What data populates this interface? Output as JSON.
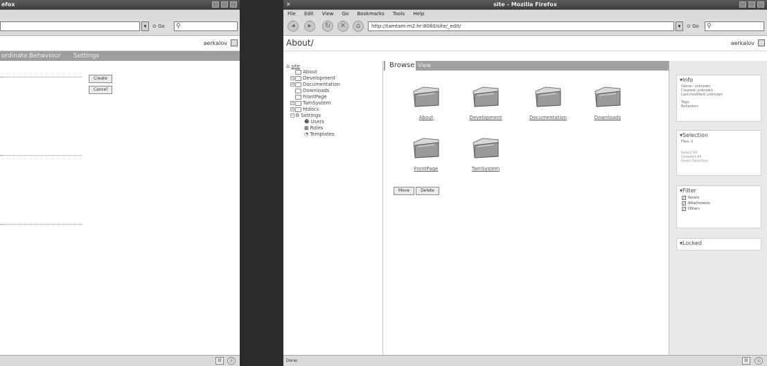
{
  "left_window": {
    "title": "efox",
    "go_label": "Go",
    "user": "aerkalov",
    "tabs": [
      "ordinate",
      "Behaviour",
      "Settings"
    ],
    "create_button": "Create",
    "cancel_button": "Cancel"
  },
  "right_window": {
    "title": "site - Mozilla Firefox",
    "menu": [
      "File",
      "Edit",
      "View",
      "Go",
      "Bookmarks",
      "Tools",
      "Help"
    ],
    "url": "http://tamtam-m2.hr:8080/site/_edit/",
    "go_label": "Go",
    "path": "About/",
    "user": "aerkalov",
    "status": "Done",
    "tree": {
      "root": "site",
      "items": [
        "About",
        "Development",
        "Documentation",
        "Downloads",
        "FrontPage",
        "TamSystem",
        "htdocs",
        "Settings"
      ],
      "settings_children": [
        "Users",
        "Roles",
        "Templates"
      ]
    },
    "browse": {
      "tabs": [
        "Browse",
        "View"
      ],
      "folders": [
        "About",
        "Development",
        "Documentation",
        "Downloads",
        "FrontPage",
        "TamSystem"
      ],
      "move_button": "Move",
      "delete_button": "Delete"
    },
    "sidebar": {
      "info": {
        "title": "Info",
        "lines": [
          "Owner: unknown",
          "Created: unknown",
          "Last modified: unknown",
          "Tags:",
          "Behaviors"
        ]
      },
      "selection": {
        "title": "Selection",
        "files": "Files: 0",
        "links": [
          "Select All",
          "Unselect All",
          "Invert Selection"
        ]
      },
      "filter": {
        "title": "Filter",
        "options": [
          "Panels",
          "Attachments",
          "Others"
        ]
      },
      "locked": {
        "title": "Locked"
      }
    }
  },
  "colors": {
    "titlebar": "#4a4a4a",
    "chrome": "#dcdcdc",
    "tab_strip": "#9e9e9e",
    "sidebar": "#e8e8e8"
  }
}
